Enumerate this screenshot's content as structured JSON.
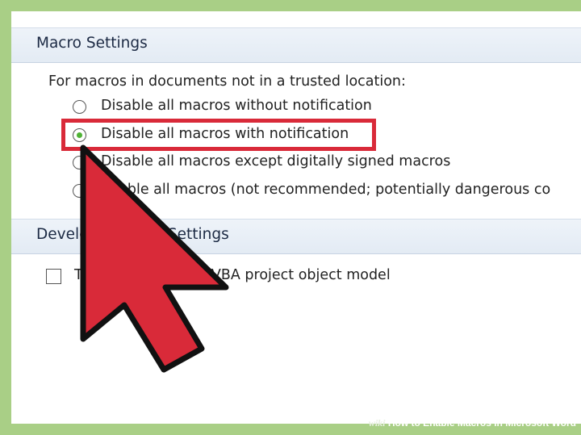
{
  "macro_settings": {
    "title": "Macro Settings",
    "intro": "For macros in documents not in a trusted location:",
    "options": [
      {
        "label": "Disable all macros without notification",
        "checked": false
      },
      {
        "label": "Disable all macros with notification",
        "checked": true
      },
      {
        "label": "Disable all macros except digitally signed macros",
        "checked": false
      },
      {
        "label": "Enable all macros (not recommended; potentially dangerous co",
        "checked": false
      }
    ]
  },
  "developer_settings": {
    "title": "Developer Macro Settings",
    "trust_vba_label": "Trust access to the VBA project object model",
    "trust_vba_checked": false
  },
  "annotation": {
    "highlight_color": "#d92a39",
    "cursor_fill": "#d92a39",
    "cursor_outline": "#111111"
  },
  "watermark": {
    "brand": "wiki",
    "text": "How to Enable Macros in Microsoft Word"
  },
  "colors": {
    "frame_green": "#a9cf86",
    "header_bg": "#e7eef6",
    "radio_checked": "#4fb335"
  }
}
